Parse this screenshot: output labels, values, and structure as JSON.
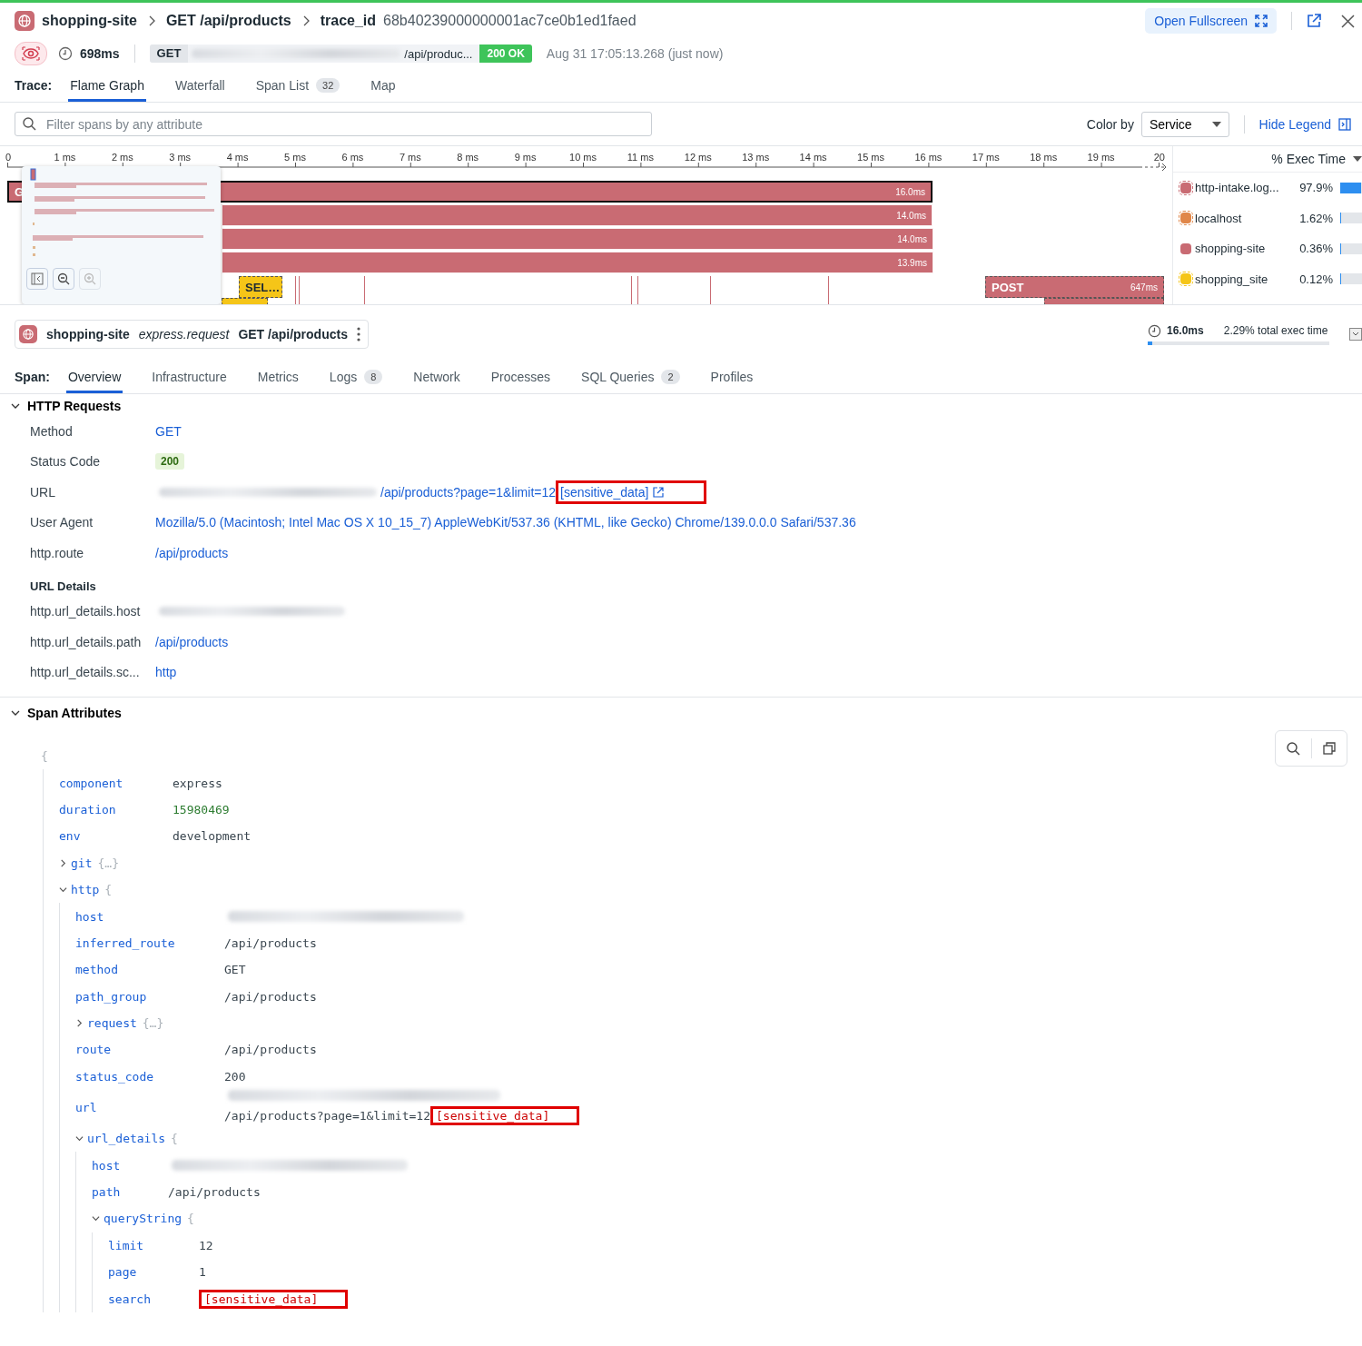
{
  "header": {
    "service": "shopping-site",
    "resource": "GET /api/products",
    "trace_label": "trace_id",
    "trace_id": "68b40239000000001ac7ce0b1ed1faed",
    "fullscreen_button": "Open Fullscreen"
  },
  "summary": {
    "duration": "698ms",
    "method": "GET",
    "path": "/api/produc...",
    "status": "200 OK",
    "timestamp": "Aug 31 17:05:13.268 (just now)"
  },
  "trace_tabs": {
    "label": "Trace:",
    "tabs": [
      {
        "label": "Flame Graph",
        "selected": true
      },
      {
        "label": "Waterfall",
        "selected": false
      },
      {
        "label": "Span List",
        "count": "32",
        "selected": false
      },
      {
        "label": "Map",
        "selected": false
      }
    ]
  },
  "filter": {
    "placeholder": "Filter spans by any attribute",
    "color_by_label": "Color by",
    "color_by_value": "Service",
    "legend_toggle": "Hide Legend"
  },
  "flame": {
    "ticks": [
      "0",
      "1 ms",
      "2 ms",
      "3 ms",
      "4 ms",
      "5 ms",
      "6 ms",
      "7 ms",
      "8 ms",
      "9 ms",
      "10 ms",
      "11 ms",
      "12 ms",
      "13 ms",
      "14 ms",
      "15 ms",
      "16 ms",
      "17 ms",
      "18 ms",
      "19 ms",
      "20"
    ],
    "spans": [
      {
        "label": "G",
        "duration": "16.0ms",
        "color": "#c96b73",
        "selected": true,
        "dashed": false
      },
      {
        "duration": "14.0ms",
        "color": "#c96b73",
        "selected": false,
        "dashed": false
      },
      {
        "duration": "14.0ms",
        "color": "#c96b73",
        "selected": false,
        "dashed": false
      },
      {
        "duration": "13.9ms",
        "color": "#c96b73",
        "selected": false,
        "dashed": false
      },
      {
        "label": "SEL…",
        "color": "#f5c518",
        "selected": false,
        "dashed": true
      },
      {
        "label": "POST",
        "duration": "647ms",
        "color": "#c96b73",
        "selected": false,
        "dashed": true
      },
      {
        "color": "#f5c518",
        "selected": false,
        "dashed": true
      },
      {
        "color": "#c96b73",
        "selected": false,
        "dashed": true
      }
    ]
  },
  "minimap": {
    "buttons": [
      {
        "kind": "collapse",
        "disabled": false
      },
      {
        "kind": "zoom-out",
        "disabled": false
      },
      {
        "kind": "zoom-in",
        "disabled": true
      }
    ]
  },
  "legend": {
    "title": "% Exec Time",
    "items": [
      {
        "name": "http-intake.log...",
        "percent": "97.9%",
        "level": 0.979,
        "color": "#c96b73",
        "dashed": true
      },
      {
        "name": "localhost",
        "percent": "1.62%",
        "level": 0.0162,
        "color": "#e0874a",
        "dashed": true
      },
      {
        "name": "shopping-site",
        "percent": "0.36%",
        "level": 0.0036,
        "color": "#c96b73",
        "dashed": false
      },
      {
        "name": "shopping_site",
        "percent": "0.12%",
        "level": 0.0012,
        "color": "#f5c518",
        "dashed": true
      }
    ]
  },
  "span": {
    "service": "shopping-site",
    "operation": "express.request",
    "resource": "GET /api/products",
    "duration": "16.0ms",
    "exec_share": "2.29% total exec time",
    "level": 0.0229
  },
  "span_tabs": {
    "label": "Span:",
    "tabs": [
      {
        "label": "Overview",
        "selected": true
      },
      {
        "label": "Infrastructure",
        "selected": false
      },
      {
        "label": "Metrics",
        "selected": false
      },
      {
        "label": "Logs",
        "count": "8",
        "selected": false
      },
      {
        "label": "Network",
        "selected": false
      },
      {
        "label": "Processes",
        "selected": false
      },
      {
        "label": "SQL Queries",
        "count": "2",
        "selected": false
      },
      {
        "label": "Profiles",
        "selected": false
      }
    ]
  },
  "http_requests": {
    "title": "HTTP Requests",
    "expanded": true,
    "rows": [
      {
        "label": "Method",
        "value": "GET",
        "kind": "link"
      },
      {
        "label": "Status Code",
        "value": "200",
        "kind": "badge"
      },
      {
        "label": "URL",
        "kind": "url",
        "value": "/api/products?page=1&limit=12",
        "redacted": "[sensitive_data]",
        "highlighted": true
      },
      {
        "label": "User Agent",
        "value": "Mozilla/5.0 (Macintosh; Intel Mac OS X 10_15_7) AppleWebKit/537.36 (KHTML, like Gecko) Chrome/139.0.0.0 Safari/537.36",
        "kind": "link"
      },
      {
        "label": "http.route",
        "value": "/api/products",
        "kind": "link"
      }
    ]
  },
  "url_details": {
    "title": "URL Details",
    "rows": [
      {
        "label": "http.url_details.host",
        "kind": "blurred"
      },
      {
        "label": "http.url_details.path",
        "value": "/api/products",
        "kind": "link"
      },
      {
        "label": "http.url_details.sc...",
        "value": "http",
        "kind": "link"
      }
    ]
  },
  "span_attributes": {
    "title": "Span Attributes",
    "expanded": true,
    "open_brace": "{",
    "tree": [
      {
        "key": "component",
        "value": "express",
        "kind": "string"
      },
      {
        "key": "duration",
        "value": "15980469",
        "kind": "number"
      },
      {
        "key": "env",
        "value": "development",
        "kind": "string"
      },
      {
        "key": "git",
        "kind": "object",
        "expanded": false,
        "brace": "{…}"
      },
      {
        "key": "http",
        "kind": "object",
        "expanded": true,
        "brace": "{",
        "children": [
          {
            "key": "host",
            "kind": "blurred"
          },
          {
            "key": "inferred_route",
            "value": "/api/products",
            "kind": "string"
          },
          {
            "key": "method",
            "value": "GET",
            "kind": "string"
          },
          {
            "key": "path_group",
            "value": "/api/products",
            "kind": "string"
          },
          {
            "key": "request",
            "kind": "object",
            "expanded": false,
            "brace": "{…}"
          },
          {
            "key": "route",
            "value": "/api/products",
            "kind": "string"
          },
          {
            "key": "status_code",
            "value": "200",
            "kind": "string"
          },
          {
            "key": "url",
            "kind": "url",
            "value": "/api/products?page=1&limit=12",
            "redacted": "[sensitive_data]",
            "highlighted": true
          },
          {
            "key": "url_details",
            "kind": "object",
            "expanded": true,
            "brace": "{",
            "children": [
              {
                "key": "host",
                "kind": "blurred"
              },
              {
                "key": "path",
                "value": "/api/products",
                "kind": "string"
              },
              {
                "key": "queryString",
                "kind": "object",
                "expanded": true,
                "brace": "{",
                "children": [
                  {
                    "key": "limit",
                    "value": "12",
                    "kind": "string"
                  },
                  {
                    "key": "page",
                    "value": "1",
                    "kind": "string"
                  },
                  {
                    "key": "search",
                    "kind": "redacted",
                    "redacted": "[sensitive_data]",
                    "highlighted": true
                  }
                ]
              }
            ]
          }
        ]
      }
    ]
  }
}
